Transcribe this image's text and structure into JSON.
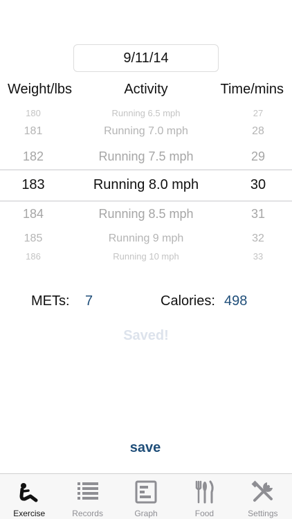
{
  "date": "9/11/14",
  "columns": {
    "weight": "Weight/lbs",
    "activity": "Activity",
    "time": "Time/mins"
  },
  "picker": {
    "rows": [
      {
        "weight": "180",
        "activity": "Running 6.5 mph",
        "time": "27"
      },
      {
        "weight": "181",
        "activity": "Running 7.0 mph",
        "time": "28"
      },
      {
        "weight": "182",
        "activity": "Running 7.5 mph",
        "time": "29"
      },
      {
        "weight": "183",
        "activity": "Running 8.0 mph",
        "time": "30"
      },
      {
        "weight": "184",
        "activity": "Running 8.5 mph",
        "time": "31"
      },
      {
        "weight": "185",
        "activity": "Running 9 mph",
        "time": "32"
      },
      {
        "weight": "186",
        "activity": "Running 10 mph",
        "time": "33"
      }
    ],
    "selected_index": 3
  },
  "stats": {
    "mets_label": "METs:",
    "mets_value": "7",
    "calories_label": "Calories:",
    "calories_value": "498"
  },
  "saved_message": "Saved!",
  "save_label": "save",
  "tabs": [
    {
      "label": "Exercise",
      "icon": "exercise-icon",
      "active": true
    },
    {
      "label": "Records",
      "icon": "list-icon",
      "active": false
    },
    {
      "label": "Graph",
      "icon": "graph-icon",
      "active": false
    },
    {
      "label": "Food",
      "icon": "fork-knife-icon",
      "active": false
    },
    {
      "label": "Settings",
      "icon": "tools-icon",
      "active": false
    }
  ],
  "colors": {
    "accent": "#1f4e79",
    "inactive_tab": "#8e8e93",
    "saved_faded": "#dde3ec"
  }
}
